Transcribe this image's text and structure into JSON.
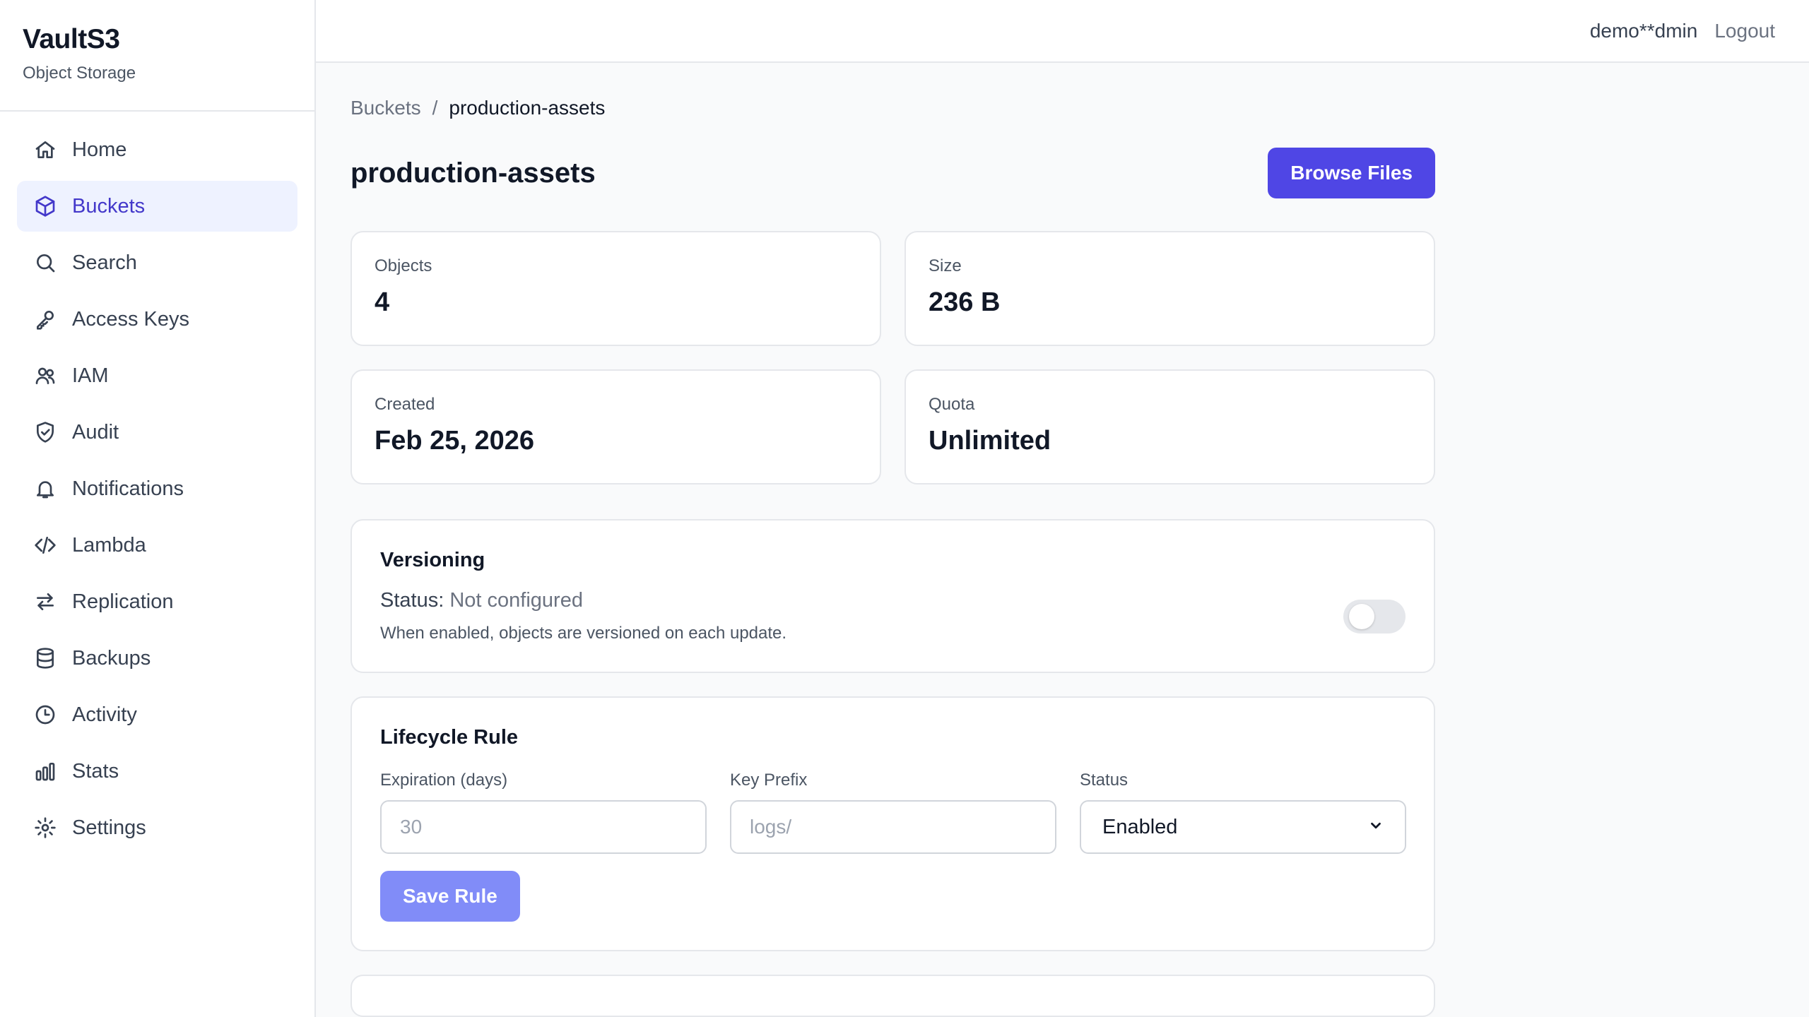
{
  "brand": {
    "name": "VaultS3",
    "subtitle": "Object Storage"
  },
  "sidebar": {
    "items": [
      {
        "label": "Home",
        "icon": "home-icon"
      },
      {
        "label": "Buckets",
        "icon": "cube-icon",
        "active": true
      },
      {
        "label": "Search",
        "icon": "search-icon"
      },
      {
        "label": "Access Keys",
        "icon": "key-icon"
      },
      {
        "label": "IAM",
        "icon": "users-icon"
      },
      {
        "label": "Audit",
        "icon": "shield-icon"
      },
      {
        "label": "Notifications",
        "icon": "bell-icon"
      },
      {
        "label": "Lambda",
        "icon": "code-icon"
      },
      {
        "label": "Replication",
        "icon": "arrows-icon"
      },
      {
        "label": "Backups",
        "icon": "database-icon"
      },
      {
        "label": "Activity",
        "icon": "clock-icon"
      },
      {
        "label": "Stats",
        "icon": "bar-chart-icon"
      },
      {
        "label": "Settings",
        "icon": "gear-icon"
      }
    ]
  },
  "header": {
    "user": "demo**dmin",
    "logout": "Logout"
  },
  "breadcrumb": {
    "root": "Buckets",
    "separator": "/",
    "current": "production-assets"
  },
  "page": {
    "title": "production-assets",
    "browse_button": "Browse Files"
  },
  "stats": {
    "objects": {
      "label": "Objects",
      "value": "4"
    },
    "size": {
      "label": "Size",
      "value": "236 B"
    },
    "created": {
      "label": "Created",
      "value": "Feb 25, 2026"
    },
    "quota": {
      "label": "Quota",
      "value": "Unlimited"
    }
  },
  "versioning": {
    "title": "Versioning",
    "status_prefix": "Status:",
    "status": "Not configured",
    "help": "When enabled, objects are versioned on each update.",
    "enabled": false
  },
  "lifecycle": {
    "title": "Lifecycle Rule",
    "expiration_label": "Expiration (days)",
    "expiration_placeholder": "30",
    "prefix_label": "Key Prefix",
    "prefix_placeholder": "logs/",
    "status_label": "Status",
    "status_value": "Enabled",
    "save_button": "Save Rule"
  },
  "colors": {
    "accent": "#4f46e5",
    "accent_light": "#818cf8",
    "active_bg": "#eef2ff"
  }
}
